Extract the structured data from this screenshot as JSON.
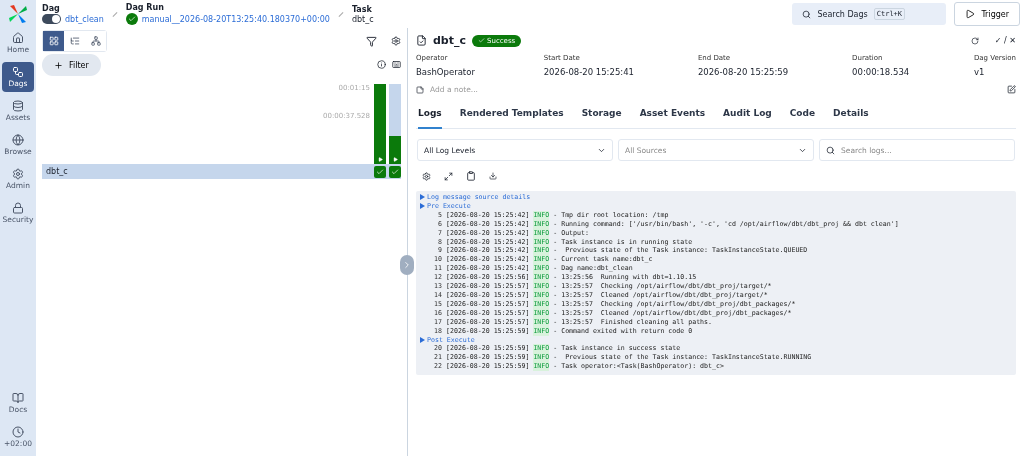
{
  "sidebar": {
    "items": [
      {
        "label": "Home",
        "selected": false
      },
      {
        "label": "Dags",
        "selected": true
      },
      {
        "label": "Assets",
        "selected": false
      },
      {
        "label": "Browse",
        "selected": false
      },
      {
        "label": "Admin",
        "selected": false
      },
      {
        "label": "Security",
        "selected": false
      }
    ],
    "bottom_items": [
      {
        "label": "Docs"
      },
      {
        "label": "+02:00"
      }
    ]
  },
  "breadcrumbs": [
    {
      "kind": "dag",
      "heading": "Dag",
      "value": "dbt_clean",
      "paused_toggle_on": true
    },
    {
      "kind": "run",
      "heading": "Dag Run",
      "value": "manual__2026-08-20T13:25:40.180370+00:00"
    },
    {
      "kind": "task",
      "heading": "Task",
      "value": "dbt_c"
    }
  ],
  "search": {
    "label": "Search Dags",
    "shortcut": "Ctrl+K"
  },
  "trigger_button": "Trigger",
  "view_toggle": [
    {
      "selected": true
    },
    {
      "selected": false
    },
    {
      "selected": false
    }
  ],
  "filter_button": "Filter",
  "grid": {
    "axis_labels": [
      "00:01:15",
      "00:00:37.528"
    ],
    "runs": [
      {
        "level": 1,
        "success": true
      },
      {
        "level": 0.35,
        "success": true
      }
    ],
    "task_row": {
      "label": "dbt_c",
      "selected": true
    }
  },
  "task": {
    "name": "dbt_c",
    "status": "Success",
    "fields": [
      {
        "label": "Operator",
        "value": "BashOperator"
      },
      {
        "label": "Start Date",
        "value": "2026-08-20 15:25:41"
      },
      {
        "label": "End Date",
        "value": "2026-08-20 15:25:59"
      },
      {
        "label": "Duration",
        "value": "00:00:18.534"
      },
      {
        "label": "Dag Version",
        "value": "v1"
      }
    ],
    "note_placeholder": "Add a note...",
    "mark_actions": "✓ / ✕"
  },
  "tabs": [
    {
      "label": "Logs",
      "selected": true
    },
    {
      "label": "Rendered Templates",
      "selected": false
    },
    {
      "label": "Storage",
      "selected": false
    },
    {
      "label": "Asset Events",
      "selected": false
    },
    {
      "label": "Audit Log",
      "selected": false
    },
    {
      "label": "Code",
      "selected": false
    },
    {
      "label": "Details",
      "selected": false
    }
  ],
  "log_filters": {
    "levels": "All Log Levels",
    "sources": "All Sources",
    "search_placeholder": "Search logs..."
  },
  "log": [
    {
      "kind": "section",
      "text": "Log message source details"
    },
    {
      "kind": "section",
      "text": "Pre Execute"
    },
    {
      "kind": "line",
      "num": "5",
      "time": "[2026-08-20 15:25:42]",
      "level": "INFO",
      "msg": "- Tmp dir root location: /tmp"
    },
    {
      "kind": "line",
      "num": "6",
      "time": "[2026-08-20 15:25:42]",
      "level": "INFO",
      "msg": "- Running command: ['/usr/bin/bash', '-c', 'cd /opt/airflow/dbt/dbt_proj && dbt clean']"
    },
    {
      "kind": "line",
      "num": "7",
      "time": "[2026-08-20 15:25:42]",
      "level": "INFO",
      "msg": "- Output:"
    },
    {
      "kind": "line",
      "num": "8",
      "time": "[2026-08-20 15:25:42]",
      "level": "INFO",
      "msg": "- Task instance is in running state"
    },
    {
      "kind": "line",
      "num": "9",
      "time": "[2026-08-20 15:25:42]",
      "level": "INFO",
      "msg": "-  Previous state of the Task instance: TaskInstanceState.QUEUED"
    },
    {
      "kind": "line",
      "num": "10",
      "time": "[2026-08-20 15:25:42]",
      "level": "INFO",
      "msg": "- Current task name:dbt_c"
    },
    {
      "kind": "line",
      "num": "11",
      "time": "[2026-08-20 15:25:42]",
      "level": "INFO",
      "msg": "- Dag name:dbt_clean"
    },
    {
      "kind": "line",
      "num": "12",
      "time": "[2026-08-20 15:25:56]",
      "level": "INFO",
      "msg": "- 13:25:56  Running with dbt=1.10.15"
    },
    {
      "kind": "line",
      "num": "13",
      "time": "[2026-08-20 15:25:57]",
      "level": "INFO",
      "msg": "- 13:25:57  Checking /opt/airflow/dbt/dbt_proj/target/*"
    },
    {
      "kind": "line",
      "num": "14",
      "time": "[2026-08-20 15:25:57]",
      "level": "INFO",
      "msg": "- 13:25:57  Cleaned /opt/airflow/dbt/dbt_proj/target/*"
    },
    {
      "kind": "line",
      "num": "15",
      "time": "[2026-08-20 15:25:57]",
      "level": "INFO",
      "msg": "- 13:25:57  Checking /opt/airflow/dbt/dbt_proj/dbt_packages/*"
    },
    {
      "kind": "line",
      "num": "16",
      "time": "[2026-08-20 15:25:57]",
      "level": "INFO",
      "msg": "- 13:25:57  Cleaned /opt/airflow/dbt/dbt_proj/dbt_packages/*"
    },
    {
      "kind": "line",
      "num": "17",
      "time": "[2026-08-20 15:25:57]",
      "level": "INFO",
      "msg": "- 13:25:57  Finished cleaning all paths."
    },
    {
      "kind": "line",
      "num": "18",
      "time": "[2026-08-20 15:25:59]",
      "level": "INFO",
      "msg": "- Command exited with return code 0"
    },
    {
      "kind": "section",
      "text": "Post Execute"
    },
    {
      "kind": "line",
      "num": "20",
      "time": "[2026-08-20 15:25:59]",
      "level": "INFO",
      "msg": "- Task instance in success state"
    },
    {
      "kind": "line",
      "num": "21",
      "time": "[2026-08-20 15:25:59]",
      "level": "INFO",
      "msg": "-  Previous state of the Task instance: TaskInstanceState.RUNNING"
    },
    {
      "kind": "line",
      "num": "22",
      "time": "[2026-08-20 15:25:59]",
      "level": "INFO",
      "msg": "- Task operator:<Task(BashOperator): dbt_c>"
    }
  ]
}
